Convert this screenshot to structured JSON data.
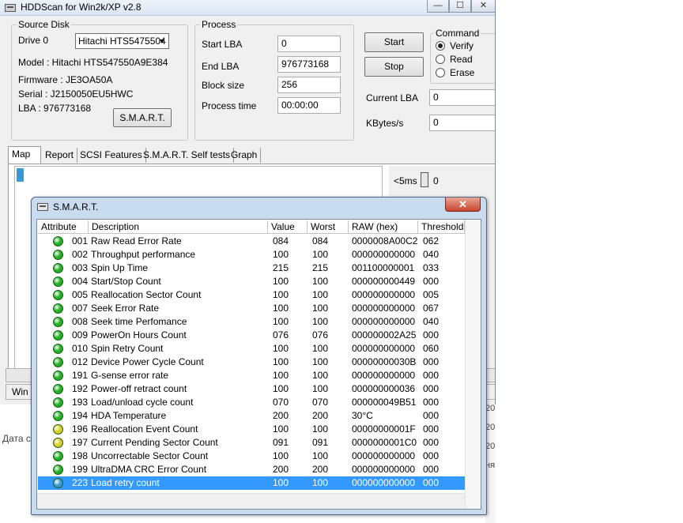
{
  "main_window": {
    "title": "HDDScan for Win2k/XP  v2.8",
    "buttons": {
      "minimize": "—",
      "maximize": "☐",
      "close": "✕"
    }
  },
  "source_disk": {
    "group_label": "Source Disk",
    "drive_label": "Drive  0",
    "drive_value": "Hitachi HTS5475504",
    "model": "Model : Hitachi HTS547550A9E384",
    "firmware": "Firmware : JE3OA50A",
    "serial": "Serial :      J2150050EU5HWC",
    "lba": "LBA :  976773168",
    "smart_button": "S.M.A.R.T."
  },
  "process": {
    "group_label": "Process",
    "start_lba_label": "Start LBA",
    "start_lba_value": "0",
    "end_lba_label": "End LBA",
    "end_lba_value": "976773168",
    "block_size_label": "Block size",
    "block_size_value": "256",
    "process_time_label": "Process time",
    "process_time_value": "00:00:00"
  },
  "actions": {
    "start": "Start",
    "stop": "Stop"
  },
  "command": {
    "group_label": "Command",
    "options": [
      "Verify",
      "Read",
      "Erase"
    ],
    "selected": "Verify"
  },
  "current": {
    "current_lba_label": "Current LBA",
    "current_lba_value": "0",
    "kbytes_label": "KBytes/s",
    "kbytes_value": "0"
  },
  "tabs": [
    "Map",
    "Report",
    "SCSI Features",
    "S.M.A.R.T. Self tests",
    "Graph"
  ],
  "map_legend": {
    "label": "<5ms",
    "count": "0"
  },
  "statusbar": {
    "text": "Win"
  },
  "background_fragments": {
    "left_text": "Дата с",
    "right_items": [
      "20",
      "20",
      "20",
      "ня"
    ]
  },
  "smart": {
    "title": "S.M.A.R.T.",
    "close": "✕",
    "columns": [
      "Attribute",
      "Description",
      "Value",
      "Worst",
      "RAW (hex)",
      "Threshold"
    ],
    "status_colors": {
      "ok": "#22b022",
      "warn": "#d8cc22",
      "selected": "#3a9ad0"
    },
    "rows": [
      {
        "status": "ok",
        "attr": "001",
        "desc": "Raw Read Error Rate",
        "value": "084",
        "worst": "084",
        "raw": "0000008A00C2",
        "threshold": "062"
      },
      {
        "status": "ok",
        "attr": "002",
        "desc": "Throughput performance",
        "value": "100",
        "worst": "100",
        "raw": "000000000000",
        "threshold": "040"
      },
      {
        "status": "ok",
        "attr": "003",
        "desc": "Spin Up Time",
        "value": "215",
        "worst": "215",
        "raw": "001100000001",
        "threshold": "033"
      },
      {
        "status": "ok",
        "attr": "004",
        "desc": "Start/Stop Count",
        "value": "100",
        "worst": "100",
        "raw": "000000000449",
        "threshold": "000"
      },
      {
        "status": "ok",
        "attr": "005",
        "desc": "Reallocation Sector Count",
        "value": "100",
        "worst": "100",
        "raw": "000000000000",
        "threshold": "005"
      },
      {
        "status": "ok",
        "attr": "007",
        "desc": "Seek Error Rate",
        "value": "100",
        "worst": "100",
        "raw": "000000000000",
        "threshold": "067"
      },
      {
        "status": "ok",
        "attr": "008",
        "desc": "Seek time Perfomance",
        "value": "100",
        "worst": "100",
        "raw": "000000000000",
        "threshold": "040"
      },
      {
        "status": "ok",
        "attr": "009",
        "desc": "PowerOn Hours Count",
        "value": "076",
        "worst": "076",
        "raw": "000000002A25",
        "threshold": "000"
      },
      {
        "status": "ok",
        "attr": "010",
        "desc": "Spin Retry Count",
        "value": "100",
        "worst": "100",
        "raw": "000000000000",
        "threshold": "060"
      },
      {
        "status": "ok",
        "attr": "012",
        "desc": "Device Power Cycle Count",
        "value": "100",
        "worst": "100",
        "raw": "00000000030B",
        "threshold": "000"
      },
      {
        "status": "ok",
        "attr": "191",
        "desc": "G-sense error rate",
        "value": "100",
        "worst": "100",
        "raw": "000000000000",
        "threshold": "000"
      },
      {
        "status": "ok",
        "attr": "192",
        "desc": "Power-off retract count",
        "value": "100",
        "worst": "100",
        "raw": "000000000036",
        "threshold": "000"
      },
      {
        "status": "ok",
        "attr": "193",
        "desc": "Load/unload cycle count",
        "value": "070",
        "worst": "070",
        "raw": "000000049B51",
        "threshold": "000"
      },
      {
        "status": "ok",
        "attr": "194",
        "desc": "HDA Temperature",
        "value": "200",
        "worst": "200",
        "raw": "30°C",
        "threshold": "000"
      },
      {
        "status": "warn",
        "attr": "196",
        "desc": "Reallocation Event Count",
        "value": "100",
        "worst": "100",
        "raw": "00000000001F",
        "threshold": "000"
      },
      {
        "status": "warn",
        "attr": "197",
        "desc": "Current Pending Sector Count",
        "value": "091",
        "worst": "091",
        "raw": "0000000001C0",
        "threshold": "000"
      },
      {
        "status": "ok",
        "attr": "198",
        "desc": "Uncorrectable Sector Count",
        "value": "100",
        "worst": "100",
        "raw": "000000000000",
        "threshold": "000"
      },
      {
        "status": "ok",
        "attr": "199",
        "desc": "UltraDMA CRC Error Count",
        "value": "200",
        "worst": "200",
        "raw": "000000000000",
        "threshold": "000"
      },
      {
        "status": "selected",
        "attr": "223",
        "desc": "Load retry count",
        "value": "100",
        "worst": "100",
        "raw": "000000000000",
        "threshold": "000"
      }
    ]
  }
}
